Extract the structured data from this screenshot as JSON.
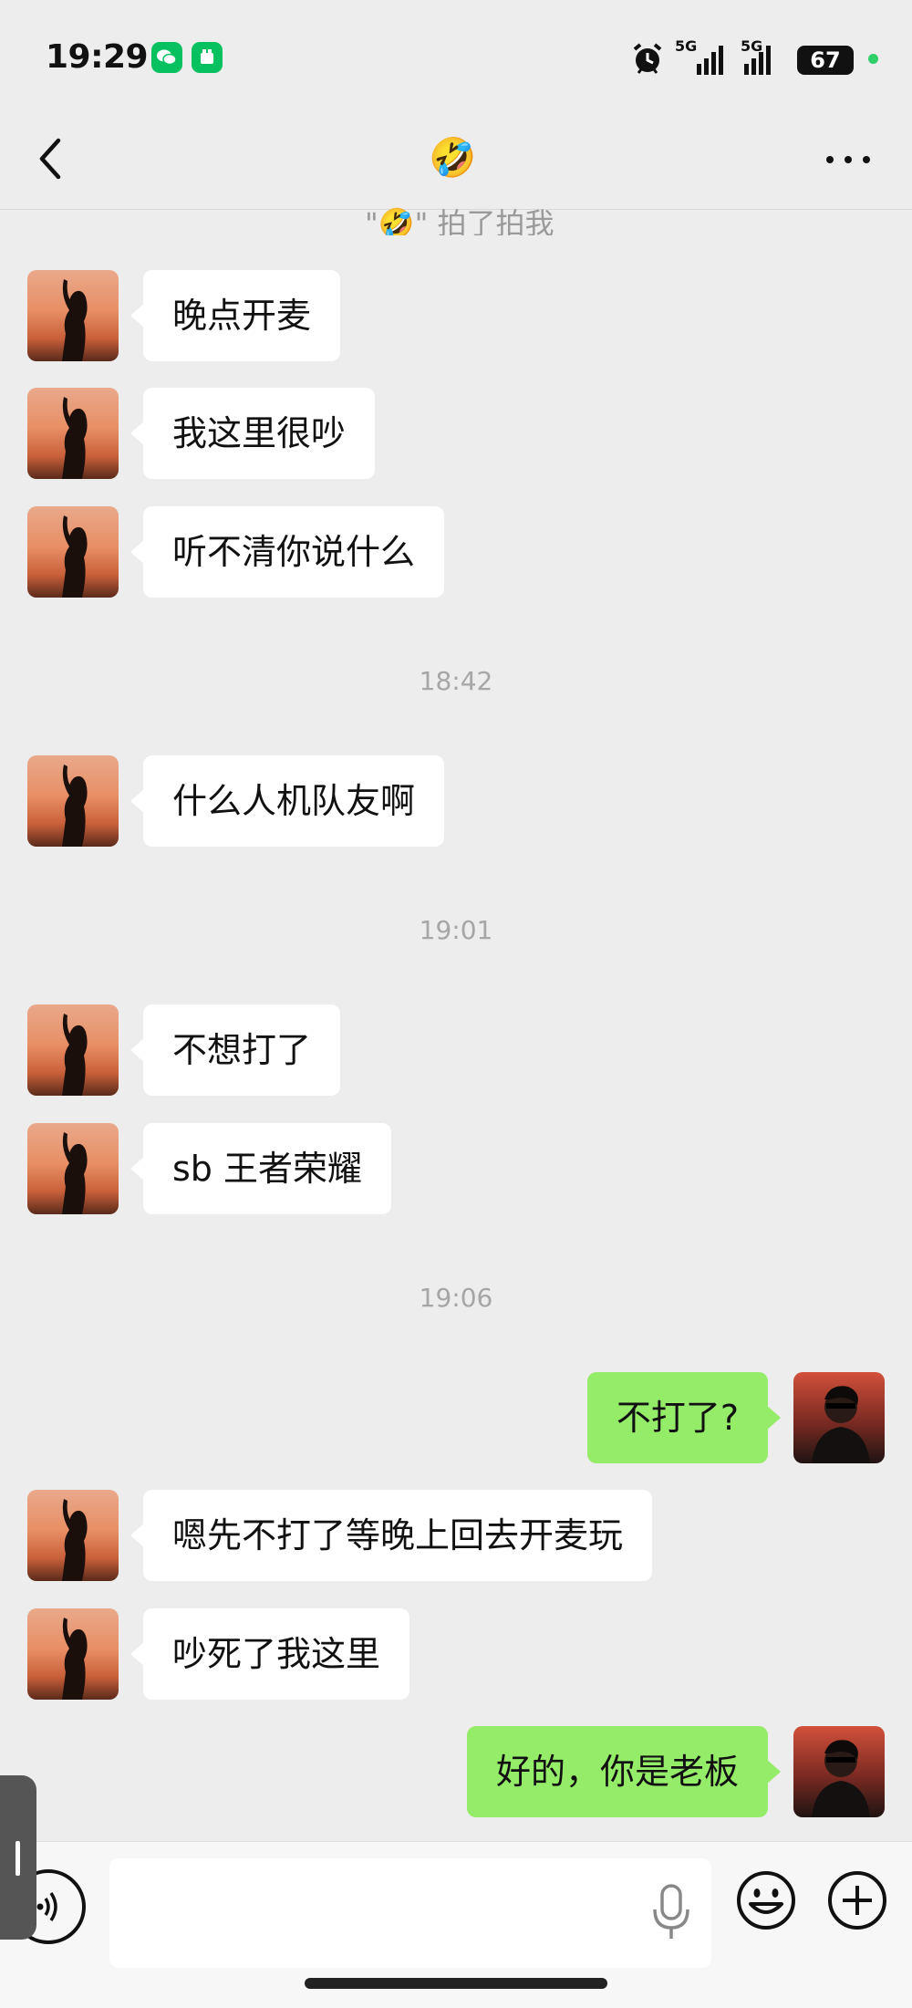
{
  "status_bar": {
    "time": "19:29",
    "battery": "67",
    "network_1": "5G",
    "network_2": "5G",
    "icons": [
      "wechat-icon",
      "app-icon",
      "alarm-icon",
      "signal-icon",
      "signal-icon",
      "battery-icon"
    ]
  },
  "header": {
    "title_emoji": "🤣",
    "back_icon": "chevron-left-icon",
    "more_icon": "more-icon"
  },
  "system_notice": {
    "pat_text": "\"🤣\" 拍了拍我"
  },
  "messages": [
    {
      "side": "left",
      "text": "晚点开麦"
    },
    {
      "side": "left",
      "text": "我这里很吵"
    },
    {
      "side": "left",
      "text": "听不清你说什么"
    },
    {
      "timestamp": "18:42"
    },
    {
      "side": "left",
      "text": "什么人机队友啊"
    },
    {
      "timestamp": "19:01"
    },
    {
      "side": "left",
      "text": "不想打了"
    },
    {
      "side": "left",
      "text": "sb 王者荣耀"
    },
    {
      "timestamp": "19:06"
    },
    {
      "side": "right",
      "text": "不打了?"
    },
    {
      "side": "left",
      "text": "嗯先不打了等晚上回去开麦玩"
    },
    {
      "side": "left",
      "text": "吵死了我这里"
    },
    {
      "side": "right",
      "text": "好的，你是老板"
    }
  ],
  "input_bar": {
    "placeholder": "",
    "value": "",
    "icons": [
      "voice-icon",
      "mic-icon",
      "emoji-icon",
      "plus-icon"
    ]
  },
  "colors": {
    "background": "#ededed",
    "bubble_in": "#ffffff",
    "bubble_out": "#95ec69",
    "timestamp": "#a6a6a6"
  }
}
